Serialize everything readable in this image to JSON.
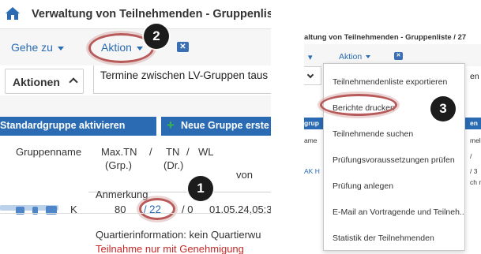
{
  "left_panel": {
    "page_title": "Verwaltung von Teilnehmenden - Gruppenliste",
    "nav": {
      "goto_label": "Gehe zu",
      "action_label": "Aktion",
      "x_icon_glyph": "✕"
    },
    "actions": {
      "toggle_label": "Aktionen",
      "selected_action": "Termine zwischen LV-Gruppen taus"
    },
    "buttons": {
      "standard_group": "Standardgruppe aktivieren",
      "new_group_plus": "+",
      "new_group": "Neue Gruppe erste"
    },
    "table": {
      "headers": {
        "group_name": "Gruppenname",
        "max_tn": "Max.TN",
        "slash1": "/",
        "tn": "TN",
        "slash2": "/",
        "wl": "WL",
        "grp": "(Grp.)",
        "dr": "(Dr.)",
        "von": "von",
        "anmerkung": "Anmerkung"
      },
      "row": {
        "max_value": "80",
        "slash": "/",
        "tn_link": "22",
        "slash_wl": "/ 0",
        "date": "01.05.24,05:3"
      },
      "note": "Quartierinformation: kein Quartierwu",
      "restriction": "Teilnahme nur mit Genehmigung"
    },
    "badges": {
      "badge1": "1",
      "badge2": "2"
    }
  },
  "right_panel": {
    "title_fragment": "altung von Teilnehmenden - Gruppenliste / 27",
    "nav": {
      "dash_fragment": "▾",
      "action_label": "Aktion",
      "x_icon_glyph": "✕"
    },
    "right_fragments": {
      "en_top": "en",
      "en_bar": "en",
      "emel": "mel",
      "slash_fragment": "/",
      "date_fragment": "/ 3",
      "chn": "ch n"
    },
    "left_fragments": {
      "grup": "grup",
      "ame": "ame",
      "ak_h": "AK H"
    },
    "dropdown": {
      "items": [
        "Teilnehmendenliste exportieren",
        "Berichte drucken",
        "Teilnehmende suchen",
        "Prüfungsvoraussetzungen prüfen",
        "Prüfung anlegen",
        "E-Mail an Vortragende und Teilneh...",
        "Statistik der Teilnehmenden"
      ]
    },
    "badges": {
      "badge3": "3"
    }
  },
  "colors": {
    "link_blue": "#2a6bb3",
    "button_bar_blue": "#2a6bb3",
    "plus_green": "#39b54a",
    "highlight_ring": "#b85a5a",
    "warning_red": "#c62828",
    "badge_black": "#1c1c1c"
  },
  "icons": {
    "home": "home-icon",
    "dropdown_caret": "caret-down-icon",
    "close_square": "close-square-icon",
    "chevron_up": "chevron-up-icon",
    "chevron_down": "chevron-down-icon"
  }
}
